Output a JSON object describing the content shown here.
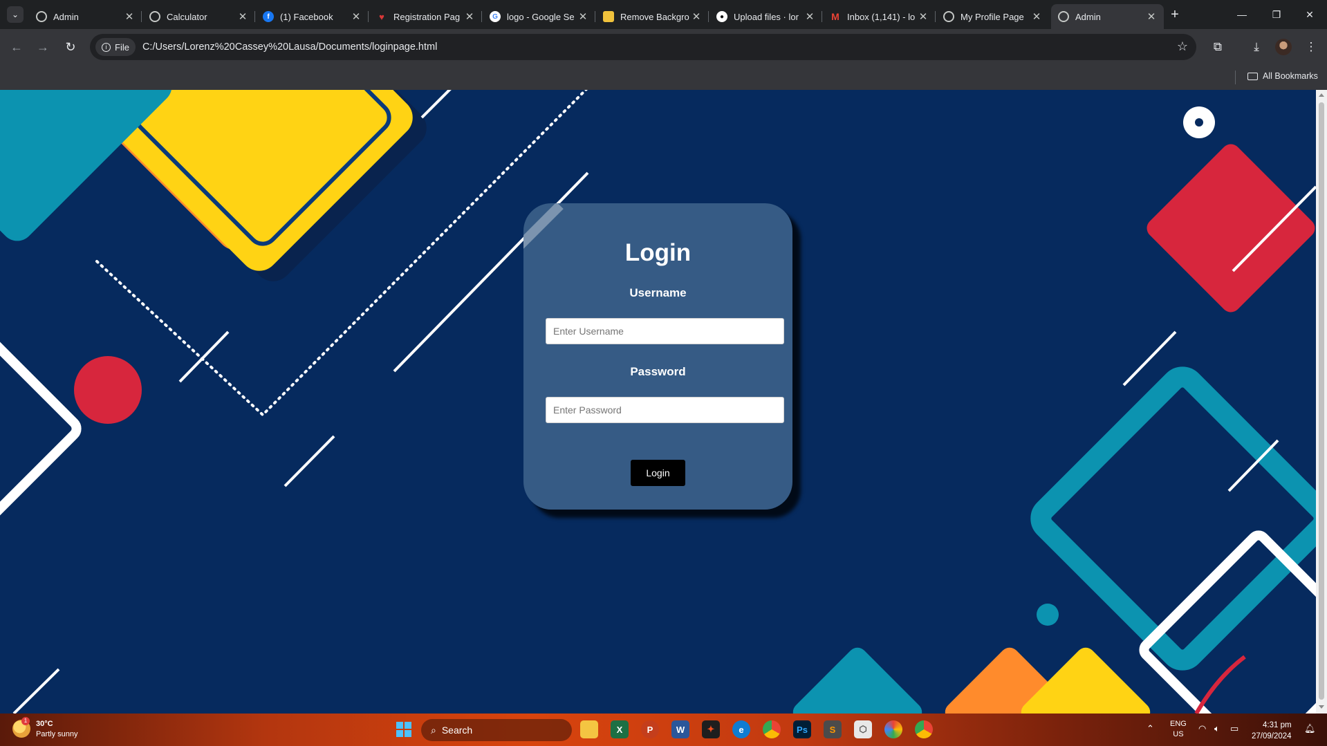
{
  "browser": {
    "tabs": [
      {
        "title": "Admin",
        "icon": "globe-icon"
      },
      {
        "title": "Calculator",
        "icon": "globe-icon"
      },
      {
        "title": "(1) Facebook",
        "icon": "facebook-icon"
      },
      {
        "title": "Registration Pag",
        "icon": "heart-icon"
      },
      {
        "title": "logo - Google Se",
        "icon": "google-icon"
      },
      {
        "title": "Remove Backgro",
        "icon": "removebg-icon"
      },
      {
        "title": "Upload files · lor",
        "icon": "github-icon"
      },
      {
        "title": "Inbox (1,141) - lo",
        "icon": "gmail-icon"
      },
      {
        "title": "My Profile Page",
        "icon": "globe-icon"
      },
      {
        "title": "Admin",
        "icon": "globe-icon",
        "active": true
      }
    ],
    "address": {
      "chip_label": "File",
      "url": "C:/Users/Lorenz%20Cassey%20Lausa/Documents/loginpage.html"
    },
    "bookmarks": {
      "all_bookmarks_label": "All Bookmarks"
    }
  },
  "page": {
    "background_color": "#062a5e",
    "login": {
      "title": "Login",
      "username_label": "Username",
      "username_placeholder": "Enter Username",
      "password_label": "Password",
      "password_placeholder": "Enter Password",
      "button_label": "Login",
      "card_color": "#365b85"
    }
  },
  "taskbar": {
    "weather": {
      "temp": "30°C",
      "condition": "Partly sunny",
      "badge": "1"
    },
    "search_label": "Search",
    "apps": [
      "file-explorer",
      "excel",
      "powerpoint",
      "word",
      "figma",
      "edge",
      "chrome",
      "photoshop",
      "sublime-text",
      "app-cube",
      "color-wheel",
      "chrome-profile"
    ],
    "tray": {
      "lang": "ENG",
      "region": "US"
    },
    "clock": {
      "time": "4:31 pm",
      "date": "27/09/2024"
    }
  }
}
